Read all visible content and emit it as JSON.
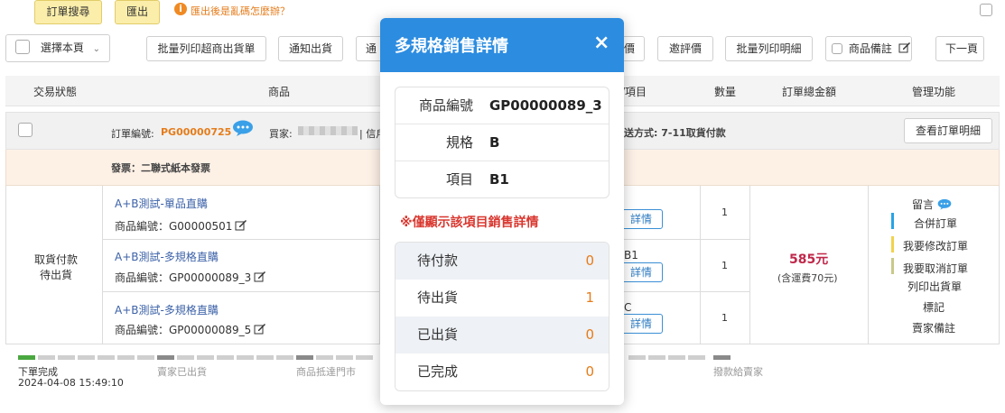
{
  "toolbar_top": {
    "order_search": "訂單搜尋",
    "export": "匯出",
    "garbled_help": "匯出後是亂碼怎麼辦？"
  },
  "toolbar": {
    "select_page": "選擇本頁",
    "batch_print_sheet": "批量列印超商出貨單",
    "notify_ship": "通知出貨",
    "hidden_btn": "通",
    "review_partial": "價",
    "invite_review": "邀評價",
    "batch_print_detail": "批量列印明細",
    "product_note": "商品備註",
    "next_page": "下一頁"
  },
  "header": {
    "status": "交易狀態",
    "product": "商品",
    "item": "/項目",
    "qty": "數量",
    "total": "訂單總金額",
    "manage": "管理功能"
  },
  "order": {
    "number_label": "訂單編號:",
    "number": "PG00000725",
    "buyer_label": "買家:",
    "buyer_suffix": "| 信戶",
    "shipping": "送方式: 7-11取貨付款",
    "view_detail": "查看訂單明細",
    "invoice": "發票：二聯式紙本發票",
    "status_line1": "取貨付款",
    "status_line2": "待出貨",
    "amount": "585元",
    "shipping_fee": "(含運費70元)"
  },
  "items": [
    {
      "name": "A+B測試-單品直購",
      "code": "商品編號：G00000501",
      "item_label": "",
      "detail": "詳情",
      "qty": "1"
    },
    {
      "name": "A+B測試-多規格直購",
      "code": "商品編號：GP00000089_3",
      "item_label": "B1",
      "detail": "詳情",
      "qty": "1"
    },
    {
      "name": "A+B測試-多規格直購",
      "code": "商品編號：GP00000089_5",
      "item_label": "C",
      "detail": "詳情",
      "qty": "1"
    }
  ],
  "manage": {
    "message": "留言",
    "merge": "合併訂單",
    "modify": "我要修改訂單",
    "cancel": "我要取消訂單",
    "print_sheet": "列印出貨單",
    "mark": "標記",
    "seller_note": "賣家備註"
  },
  "progress": {
    "step1": "下單完成",
    "step1_time": "2024-04-08 15:49:10",
    "step2": "賣家已出貨",
    "step3": "商品抵達門市",
    "step4": "撥款給賣家"
  },
  "modal": {
    "title": "多規格銷售詳情",
    "close": "×",
    "info": [
      {
        "label": "商品編號",
        "value": "GP00000089_3"
      },
      {
        "label": "規格",
        "value": "B"
      },
      {
        "label": "項目",
        "value": "B1"
      }
    ],
    "notice": "※僅顯示該項目銷售詳情",
    "stats": [
      {
        "label": "待付款",
        "value": "0"
      },
      {
        "label": "待出貨",
        "value": "1"
      },
      {
        "label": "已出貨",
        "value": "0"
      },
      {
        "label": "已完成",
        "value": "0"
      }
    ]
  },
  "colors": {
    "accent": "#2c8ce0",
    "order_number": "#e57c1b",
    "amount": "#c0284a",
    "notice": "#d9372f",
    "merge_bar": "#29a3e6",
    "modify_bar": "#f2d24b",
    "cancel_bar": "#c9c98a"
  }
}
